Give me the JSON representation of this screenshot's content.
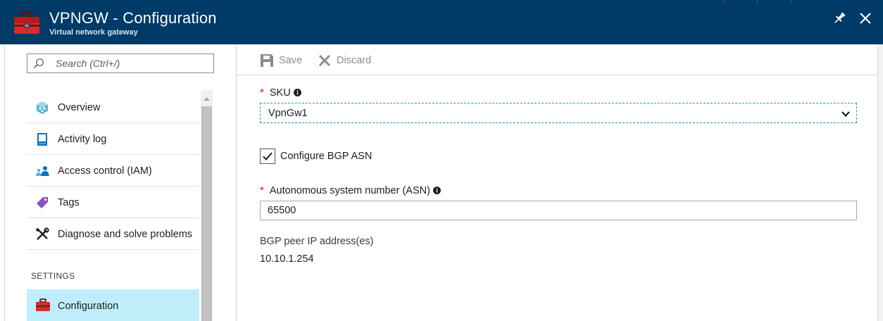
{
  "header": {
    "title": "VPNGW - Configuration",
    "subtitle": "Virtual network gateway",
    "icon": "toolbox-icon",
    "pin_icon": "pin-icon",
    "close_icon": "close-icon",
    "background": "#003a66"
  },
  "search": {
    "placeholder": "Search (Ctrl+/)"
  },
  "menu": {
    "items": [
      {
        "label": "Overview",
        "icon": "overview-icon"
      },
      {
        "label": "Activity log",
        "icon": "activity-log-icon"
      },
      {
        "label": "Access control (IAM)",
        "icon": "iam-users-icon"
      },
      {
        "label": "Tags",
        "icon": "tag-icon"
      },
      {
        "label": "Diagnose and solve problems",
        "icon": "wrench-screwdriver-icon"
      }
    ],
    "section_settings": "SETTINGS",
    "active_item": {
      "label": "Configuration",
      "icon": "toolbox-icon",
      "highlight": "#bfeefa"
    }
  },
  "toolbar": {
    "save_label": "Save",
    "discard_label": "Discard",
    "disabled_color": "#8c8c8c"
  },
  "form": {
    "sku": {
      "required_marker": "*",
      "label": "SKU",
      "value": "VpnGw1"
    },
    "bgp_checkbox": {
      "label": "Configure BGP ASN",
      "checked": true
    },
    "asn": {
      "required_marker": "*",
      "label": "Autonomous system number (ASN)",
      "value": "65500"
    },
    "bgp_peer": {
      "label": "BGP peer IP address(es)",
      "value": "10.10.1.254"
    }
  }
}
